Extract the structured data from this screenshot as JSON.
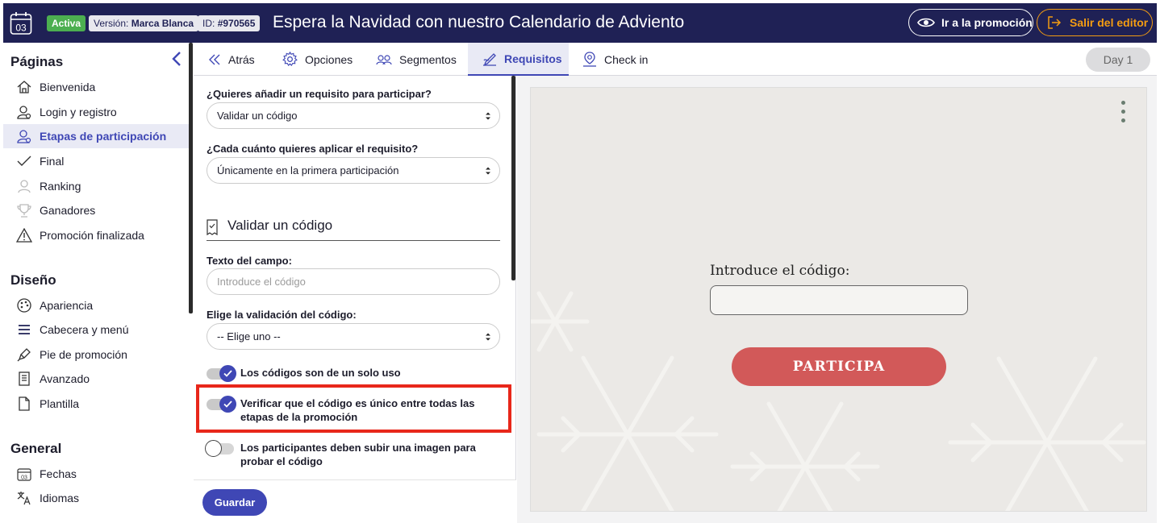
{
  "header": {
    "calendar_day": "03",
    "status_badge": "Activa",
    "version_label": "Versión:",
    "version_value": "Marca Blanca",
    "id_label": "ID:",
    "id_value": "#970565",
    "title": "Espera la Navidad con nuestro Calendario de Adviento",
    "promo_button": "Ir a la promoción",
    "exit_button": "Salir del editor",
    "colors": {
      "bar": "#1f2155",
      "exit": "#f39c12",
      "active": "#4caf50"
    }
  },
  "sidebar": {
    "sections": [
      {
        "heading": "Páginas",
        "items": [
          {
            "label": "Bienvenida",
            "icon": "home-icon"
          },
          {
            "label": "Login y registro",
            "icon": "user-icon"
          },
          {
            "label": "Etapas de participación",
            "icon": "user-active-icon",
            "active": true
          },
          {
            "label": "Final",
            "icon": "check-icon"
          },
          {
            "label": "Ranking",
            "icon": "ranking-icon"
          },
          {
            "label": "Ganadores",
            "icon": "trophy-icon"
          },
          {
            "label": "Promoción finalizada",
            "icon": "warning-icon"
          }
        ]
      },
      {
        "heading": "Diseño",
        "items": [
          {
            "label": "Apariencia",
            "icon": "palette-icon"
          },
          {
            "label": "Cabecera y menú",
            "icon": "menu-icon"
          },
          {
            "label": "Pie de promoción",
            "icon": "pen-icon"
          },
          {
            "label": "Avanzado",
            "icon": "document-icon"
          },
          {
            "label": "Plantilla",
            "icon": "file-icon"
          }
        ]
      },
      {
        "heading": "General",
        "items": [
          {
            "label": "Fechas",
            "icon": "calendar-icon"
          },
          {
            "label": "Idiomas",
            "icon": "translate-icon"
          }
        ]
      }
    ]
  },
  "tabs": {
    "items": [
      {
        "label": "Atrás",
        "icon": "double-chevron-left-icon"
      },
      {
        "label": "Opciones",
        "icon": "gear-icon"
      },
      {
        "label": "Segmentos",
        "icon": "users-icon"
      },
      {
        "label": "Requisitos",
        "icon": "signature-icon",
        "active": true
      },
      {
        "label": "Check in",
        "icon": "location-user-icon"
      }
    ],
    "day_button": "Day 1"
  },
  "form": {
    "requirement_label": "¿Quieres añadir un requisito para participar?",
    "requirement_value": "Validar un código",
    "frequency_label": "¿Cada cuánto quieres aplicar el requisito?",
    "frequency_value": "Únicamente en la primera participación",
    "section_title": "Validar un código",
    "field_text_label": "Texto del campo:",
    "field_text_placeholder": "Introduce el código",
    "validation_label": "Elige la validación del código:",
    "validation_value": "-- Elige uno --",
    "toggles": [
      {
        "label": "Los códigos son de un solo uso",
        "on": true
      },
      {
        "label": "Verificar que el código es único entre todas las etapas de la promoción",
        "on": true
      },
      {
        "label": "Los participantes deben subir una imagen para probar el código",
        "on": false
      }
    ],
    "save_button": "Guardar"
  },
  "preview": {
    "code_label": "Introduce el código:",
    "participate_button": "PARTICIPA",
    "colors": {
      "button": "#d25959",
      "background": "#ebe9e6"
    }
  }
}
